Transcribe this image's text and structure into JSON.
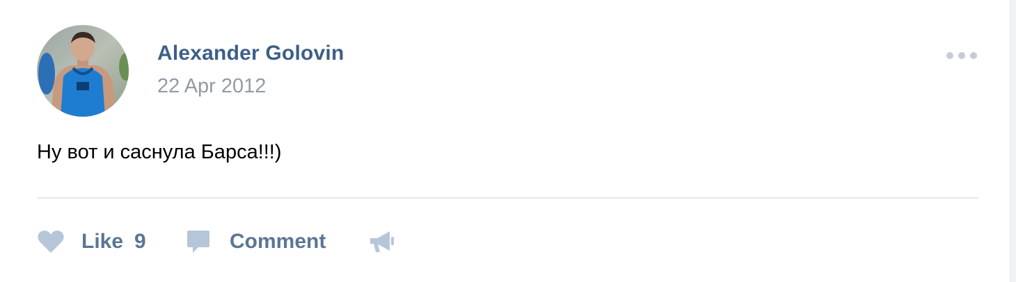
{
  "post": {
    "author": "Alexander Golovin",
    "date": "22 Apr 2012",
    "text": "Ну вот и саснула Барса!!!)",
    "avatar_icon": "user-photo",
    "more_icon": "ellipsis-horizontal-icon"
  },
  "actions": {
    "like_label": "Like",
    "like_count": "9",
    "like_icon": "heart-icon",
    "comment_label": "Comment",
    "comment_icon": "speech-bubble-icon",
    "share_icon": "megaphone-icon"
  },
  "colors": {
    "link": "#3d5f86",
    "date": "#929aa6",
    "action_text": "#5b7694",
    "icon": "#b6c6d9",
    "divider": "#e7e8ec"
  }
}
